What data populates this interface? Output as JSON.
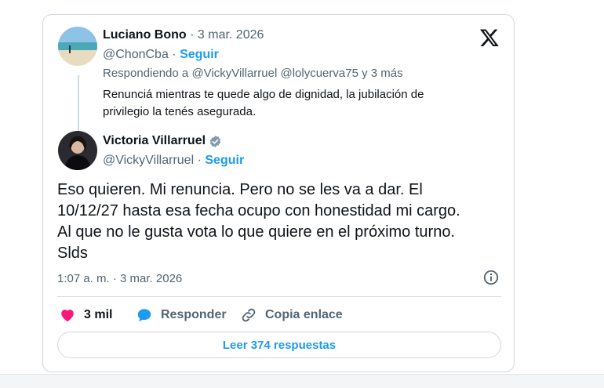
{
  "reply_tweet": {
    "author_name": "Luciano Bono",
    "separator": "·",
    "date": "3 mar. 2026",
    "handle": "@ChonCba",
    "follow_label": "Seguir",
    "replying_prefix": "Respondiendo a",
    "replying_to": "@VickyVillarruel @lolycuerva75 y 3 más",
    "text": "Renunciá mientras te quede algo de dignidad, la jubilación de privilegio la tenés asegurada."
  },
  "main_tweet": {
    "author_name": "Victoria Villarruel",
    "verified": true,
    "handle": "@VickyVillarruel",
    "separator": "·",
    "follow_label": "Seguir",
    "text_lines": [
      "Eso quieren. Mi renuncia. Pero no se les va a dar. El",
      "10/12/27 hasta esa fecha ocupo con honestidad mi cargo.",
      "Al que no le gusta vota lo que quiere en el próximo turno.",
      "Slds"
    ],
    "timestamp": "1:07 a. m. · 3 mar. 2026"
  },
  "actions": {
    "likes": "3 mil",
    "reply_label": "Responder",
    "copy_link_label": "Copia enlace",
    "read_replies_label": "Leer 374 respuestas"
  },
  "colors": {
    "accent": "#1d9bf0",
    "like": "#f91880",
    "muted": "#536471",
    "border": "#cfd9de"
  },
  "icons": [
    "x-logo-icon",
    "verified-badge-icon",
    "info-icon",
    "heart-icon",
    "reply-bubble-icon",
    "link-icon"
  ]
}
